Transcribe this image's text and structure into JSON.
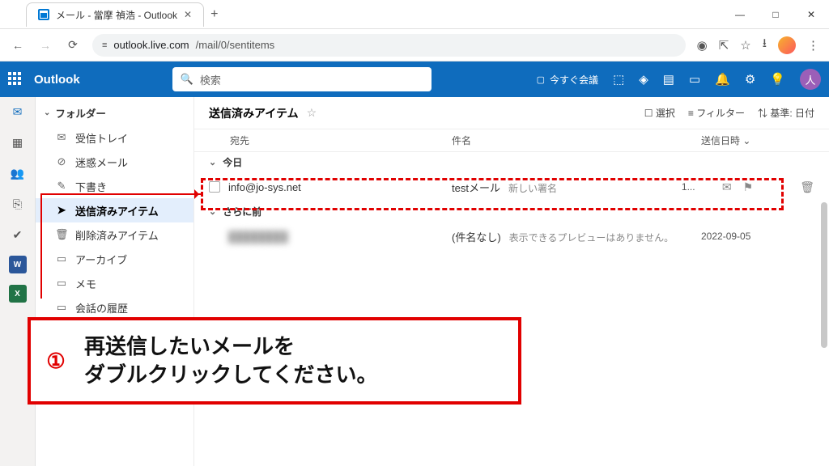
{
  "window": {
    "tab_title": "メール - 當摩 禎浩 - Outlook",
    "minimize": "—",
    "maximize": "□",
    "close": "✕",
    "newtab": "+"
  },
  "address": {
    "back": "←",
    "forward": "→",
    "reload": "⟳",
    "lock": "≡",
    "host": "outlook.live.com",
    "path": "/mail/0/sentitems",
    "icons": {
      "eye": "◉",
      "ext": "⇱",
      "star": "☆",
      "dl": "⭳",
      "menu": "⋮"
    }
  },
  "header": {
    "brand": "Outlook",
    "search_placeholder": "検索",
    "meet_now": "今すぐ会議",
    "user_initial": "人"
  },
  "rail": {
    "teams": "T",
    "word": "W",
    "excel": "X"
  },
  "sidebar": {
    "folders_label": "フォルダー",
    "items": [
      {
        "icon": "✉",
        "label": "受信トレイ"
      },
      {
        "icon": "⊘",
        "label": "迷惑メール"
      },
      {
        "icon": "✎",
        "label": "下書き"
      },
      {
        "icon": "➤",
        "label": "送信済みアイテム"
      },
      {
        "icon": "🗑",
        "label": "削除済みアイテム"
      },
      {
        "icon": "▭",
        "label": "アーカイブ"
      },
      {
        "icon": "▭",
        "label": "メモ"
      },
      {
        "icon": "▭",
        "label": "会話の履歴"
      }
    ]
  },
  "list": {
    "title": "送信済みアイテム",
    "tool_select": "選択",
    "tool_filter": "フィルター",
    "tool_sort": "基準: 日付",
    "col_to": "宛先",
    "col_subject": "件名",
    "col_date": "送信日時",
    "group_today": "今日",
    "group_older": "さらに前",
    "rows": [
      {
        "to": "info@jo-sys.net",
        "subject": "testメール",
        "preview": "新しい署名",
        "date": "1..."
      },
      {
        "to": "████████",
        "subject": "(件名なし)",
        "preview": "表示できるプレビューはありません。",
        "date": "2022-09-05"
      }
    ]
  },
  "callout": {
    "num": "①",
    "line1": "再送信したいメールを",
    "line2": "ダブルクリックしてください。"
  }
}
